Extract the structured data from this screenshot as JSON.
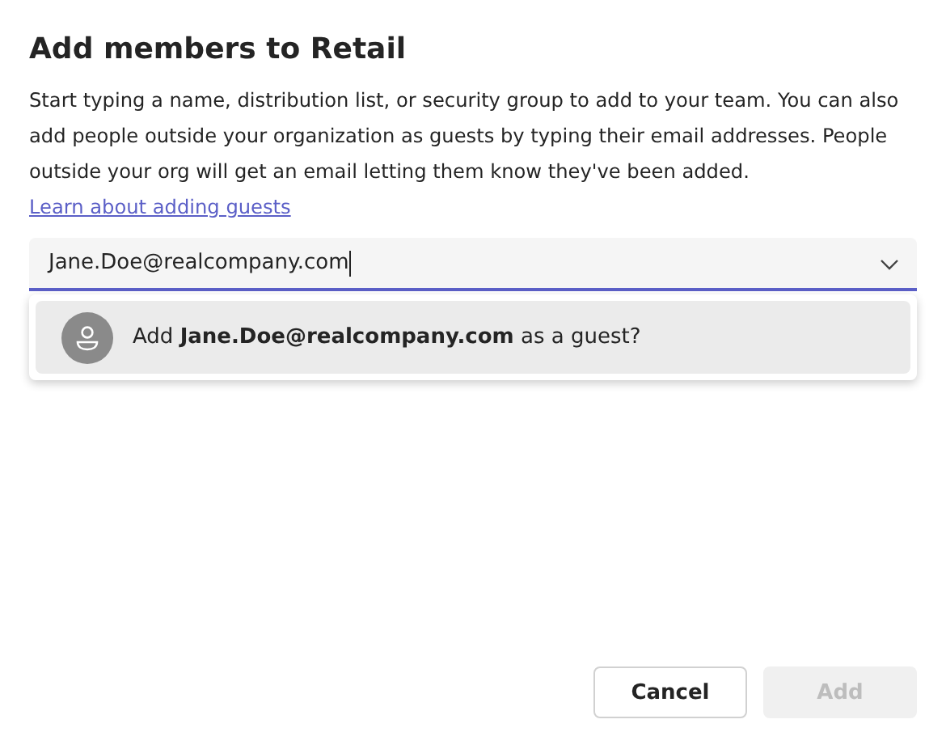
{
  "dialog": {
    "title": "Add members to Retail",
    "description": "Start typing a name, distribution list, or security group to add to your team. You can also add people outside your organization as guests by typing their email addresses. People outside your org will get an email letting them know they've been added.",
    "link": "Learn about adding guests"
  },
  "people_field": {
    "value": "Jane.Doe@realcompany.com",
    "expanded": true
  },
  "suggestions": [
    {
      "text": "Add **Jane.Doe@realcompany.com** as a guest?",
      "selected": true
    }
  ],
  "buttons": [
    {
      "label": "Cancel",
      "kind": "secondary",
      "disabled": false
    },
    {
      "label": "Add",
      "kind": "primary",
      "disabled": true
    }
  ]
}
